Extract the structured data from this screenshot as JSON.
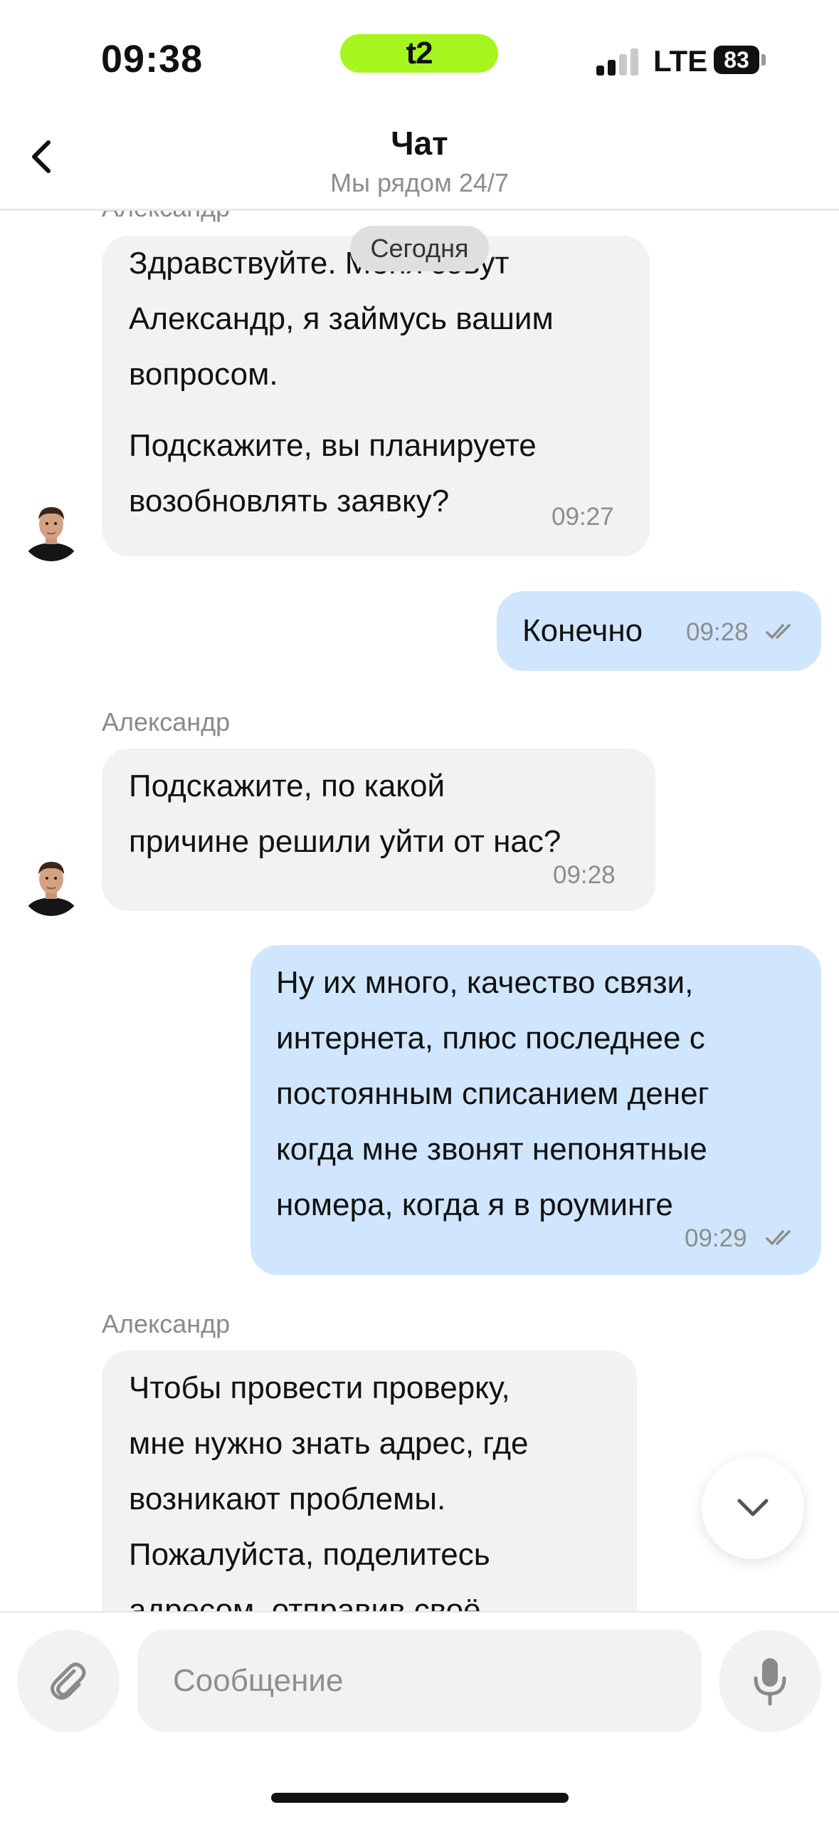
{
  "status_bar": {
    "time": "09:38",
    "carrier": "t2",
    "network": "LTE",
    "battery": "83"
  },
  "header": {
    "title": "Чат",
    "subtitle": "Мы рядом 24/7"
  },
  "chat": {
    "date_separator": "Сегодня",
    "messages": [
      {
        "direction": "in",
        "sender": "Александр",
        "lines": [
          "Здравствуйте. Меня зовут",
          "Александр, я займусь вашим",
          "вопросом."
        ],
        "lines_2": [
          "Подскажите, вы планируете",
          "возобновлять заявку?"
        ],
        "time": "09:27"
      },
      {
        "direction": "out",
        "lines": [
          "Конечно"
        ],
        "time": "09:28"
      },
      {
        "direction": "in",
        "sender": "Александр",
        "lines": [
          "Подскажите, по какой",
          "причине решили уйти от нас?"
        ],
        "time": "09:28"
      },
      {
        "direction": "out",
        "lines": [
          "Ну их много, качество связи,",
          "интернета, плюс последнее с",
          "постоянным списанием денег",
          "когда мне звонят непонятные",
          "номера, когда я в роуминге"
        ],
        "time": "09:29"
      },
      {
        "direction": "in",
        "sender": "Александр",
        "lines": [
          "Чтобы провести проверку,",
          "мне нужно знать адрес, где",
          "возникают проблемы.",
          "Пожалуйста, поделитесь",
          "адресом, отправив своё"
        ]
      }
    ]
  },
  "composer": {
    "placeholder": "Сообщение"
  },
  "colors": {
    "incoming_bubble": "#f2f2f2",
    "outgoing_bubble": "#cfe6fe",
    "carrier_accent": "#a6f51f"
  },
  "icons": [
    "back-chevron-icon",
    "double-check-icon",
    "chevron-down-icon",
    "paperclip-icon",
    "microphone-icon",
    "signal-icon",
    "battery-icon"
  ]
}
